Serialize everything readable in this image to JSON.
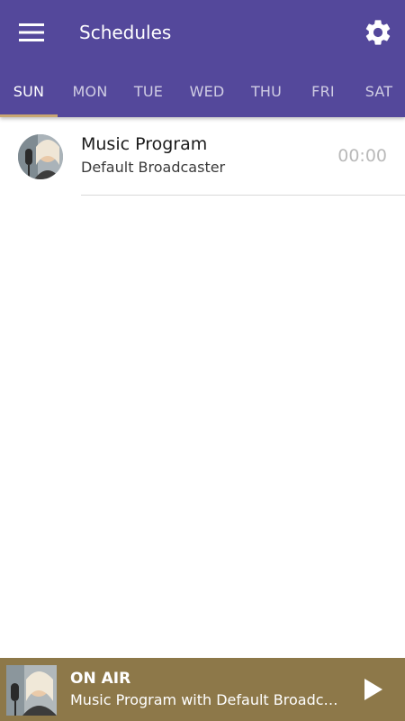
{
  "header": {
    "title": "Schedules",
    "menu_icon": "hamburger-menu-icon",
    "settings_icon": "gear-icon",
    "background_color": "#54489b"
  },
  "tabs": [
    {
      "label": "SUN",
      "active": true
    },
    {
      "label": "MON",
      "active": false
    },
    {
      "label": "TUE",
      "active": false
    },
    {
      "label": "WED",
      "active": false
    },
    {
      "label": "THU",
      "active": false
    },
    {
      "label": "FRI",
      "active": false
    },
    {
      "label": "SAT",
      "active": false
    }
  ],
  "tab_indicator_color": "#c8a672",
  "schedule": {
    "items": [
      {
        "title": "Music Program",
        "subtitle": "Default Broadcaster",
        "time": "00:00",
        "avatar_icon": "host-avatar"
      }
    ]
  },
  "player": {
    "status": "ON AIR",
    "track": "Music Program with Default Broadcaster",
    "play_icon": "play-icon",
    "background_color": "#8d7849"
  }
}
